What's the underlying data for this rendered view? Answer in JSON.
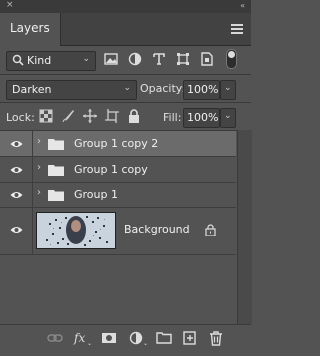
{
  "panel": {
    "tab_label": "Layers",
    "collapse_glyph": "«",
    "close_glyph": "×"
  },
  "filter": {
    "kind_label": "Kind",
    "icons": [
      "image-filter-icon",
      "adjustment-filter-icon",
      "type-filter-icon",
      "shape-filter-icon",
      "smart-object-filter-icon"
    ]
  },
  "blend": {
    "mode": "Darken",
    "opacity_label": "Opacity:",
    "opacity_value": "100%"
  },
  "lock": {
    "label": "Lock:",
    "fill_label": "Fill:",
    "fill_value": "100%"
  },
  "layers": [
    {
      "name": "Group 1 copy 2",
      "type": "group",
      "selected": true
    },
    {
      "name": "Group 1 copy",
      "type": "group",
      "selected": false
    },
    {
      "name": "Group 1",
      "type": "group",
      "selected": false
    },
    {
      "name": "Background",
      "type": "pixel",
      "locked": true
    }
  ],
  "bottom_icons": [
    "link-layers-icon",
    "fx-icon",
    "add-mask-icon",
    "adjustment-layer-icon",
    "new-group-icon",
    "new-layer-icon",
    "delete-layer-icon"
  ],
  "colors": {
    "panel_bg": "#535353",
    "selected_row": "#6b6b6b"
  }
}
